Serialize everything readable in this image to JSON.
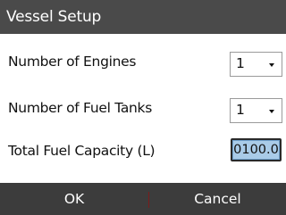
{
  "dialog": {
    "title": "Vessel Setup",
    "rows": {
      "engines": {
        "label": "Number of Engines",
        "value": "1"
      },
      "tanks": {
        "label": "Number of Fuel Tanks",
        "value": "1"
      },
      "capacity": {
        "label": "Total Fuel Capacity (L)",
        "value": "0100.0"
      }
    },
    "buttons": {
      "ok": "OK",
      "cancel": "Cancel"
    }
  },
  "colors": {
    "title_bar": "#4a4a4a",
    "button_bar": "#3c3c3c",
    "input_highlight": "#a9cbe8"
  },
  "icons": {
    "dropdown": "chevron-down-icon"
  }
}
